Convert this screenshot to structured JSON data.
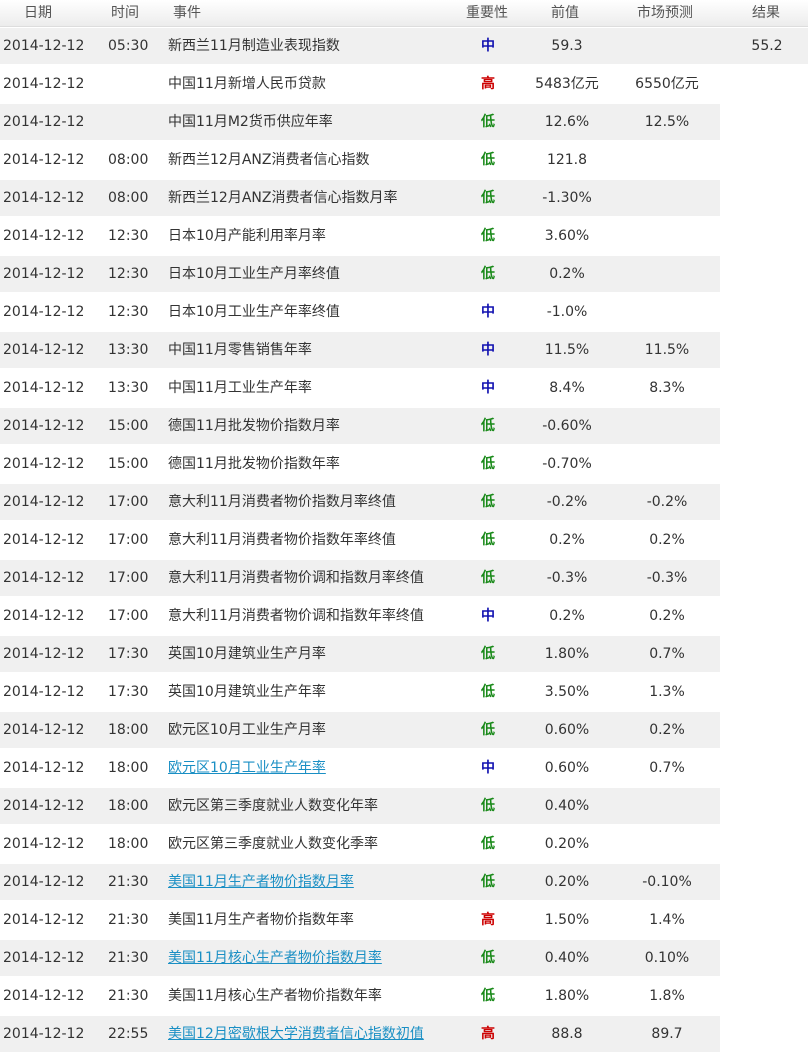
{
  "header": {
    "date": "日期",
    "time": "时间",
    "event": "事件",
    "importance": "重要性",
    "previous": "前值",
    "forecast": "市场预测",
    "result": "结果"
  },
  "importance_colors": {
    "高": "#cc0000",
    "中": "#1010b0",
    "低": "#1a8a1a"
  },
  "link_color": "#1a8fc4",
  "rows": [
    {
      "date": "2014-12-12",
      "time": "05:30",
      "event": "新西兰11月制造业表现指数",
      "importance": "中",
      "previous": "59.3",
      "forecast": "",
      "result": "55.2",
      "link": false
    },
    {
      "date": "2014-12-12",
      "time": "",
      "event": "中国11月新增人民币贷款",
      "importance": "高",
      "previous": "5483亿元",
      "forecast": "6550亿元",
      "result": "",
      "link": false
    },
    {
      "date": "2014-12-12",
      "time": "",
      "event": "中国11月M2货币供应年率",
      "importance": "低",
      "previous": "12.6%",
      "forecast": "12.5%",
      "result": "",
      "link": false
    },
    {
      "date": "2014-12-12",
      "time": "08:00",
      "event": "新西兰12月ANZ消费者信心指数",
      "importance": "低",
      "previous": "121.8",
      "forecast": "",
      "result": "",
      "link": false
    },
    {
      "date": "2014-12-12",
      "time": "08:00",
      "event": "新西兰12月ANZ消费者信心指数月率",
      "importance": "低",
      "previous": "-1.30%",
      "forecast": "",
      "result": "",
      "link": false
    },
    {
      "date": "2014-12-12",
      "time": "12:30",
      "event": "日本10月产能利用率月率",
      "importance": "低",
      "previous": "3.60%",
      "forecast": "",
      "result": "",
      "link": false
    },
    {
      "date": "2014-12-12",
      "time": "12:30",
      "event": "日本10月工业生产月率终值",
      "importance": "低",
      "previous": "0.2%",
      "forecast": "",
      "result": "",
      "link": false
    },
    {
      "date": "2014-12-12",
      "time": "12:30",
      "event": "日本10月工业生产年率终值",
      "importance": "中",
      "previous": "-1.0%",
      "forecast": "",
      "result": "",
      "link": false
    },
    {
      "date": "2014-12-12",
      "time": "13:30",
      "event": "中国11月零售销售年率",
      "importance": "中",
      "previous": "11.5%",
      "forecast": "11.5%",
      "result": "",
      "link": false
    },
    {
      "date": "2014-12-12",
      "time": "13:30",
      "event": "中国11月工业生产年率",
      "importance": "中",
      "previous": "8.4%",
      "forecast": "8.3%",
      "result": "",
      "link": false
    },
    {
      "date": "2014-12-12",
      "time": "15:00",
      "event": "德国11月批发物价指数月率",
      "importance": "低",
      "previous": "-0.60%",
      "forecast": "",
      "result": "",
      "link": false
    },
    {
      "date": "2014-12-12",
      "time": "15:00",
      "event": "德国11月批发物价指数年率",
      "importance": "低",
      "previous": "-0.70%",
      "forecast": "",
      "result": "",
      "link": false
    },
    {
      "date": "2014-12-12",
      "time": "17:00",
      "event": "意大利11月消费者物价指数月率终值",
      "importance": "低",
      "previous": "-0.2%",
      "forecast": "-0.2%",
      "result": "",
      "link": false
    },
    {
      "date": "2014-12-12",
      "time": "17:00",
      "event": "意大利11月消费者物价指数年率终值",
      "importance": "低",
      "previous": "0.2%",
      "forecast": "0.2%",
      "result": "",
      "link": false
    },
    {
      "date": "2014-12-12",
      "time": "17:00",
      "event": "意大利11月消费者物价调和指数月率终值",
      "importance": "低",
      "previous": "-0.3%",
      "forecast": "-0.3%",
      "result": "",
      "link": false
    },
    {
      "date": "2014-12-12",
      "time": "17:00",
      "event": "意大利11月消费者物价调和指数年率终值",
      "importance": "中",
      "previous": "0.2%",
      "forecast": "0.2%",
      "result": "",
      "link": false
    },
    {
      "date": "2014-12-12",
      "time": "17:30",
      "event": "英国10月建筑业生产月率",
      "importance": "低",
      "previous": "1.80%",
      "forecast": "0.7%",
      "result": "",
      "link": false
    },
    {
      "date": "2014-12-12",
      "time": "17:30",
      "event": "英国10月建筑业生产年率",
      "importance": "低",
      "previous": "3.50%",
      "forecast": "1.3%",
      "result": "",
      "link": false
    },
    {
      "date": "2014-12-12",
      "time": "18:00",
      "event": "欧元区10月工业生产月率",
      "importance": "低",
      "previous": "0.60%",
      "forecast": "0.2%",
      "result": "",
      "link": false
    },
    {
      "date": "2014-12-12",
      "time": "18:00",
      "event": "欧元区10月工业生产年率",
      "importance": "中",
      "previous": "0.60%",
      "forecast": "0.7%",
      "result": "",
      "link": true
    },
    {
      "date": "2014-12-12",
      "time": "18:00",
      "event": "欧元区第三季度就业人数变化年率",
      "importance": "低",
      "previous": "0.40%",
      "forecast": "",
      "result": "",
      "link": false
    },
    {
      "date": "2014-12-12",
      "time": "18:00",
      "event": "欧元区第三季度就业人数变化季率",
      "importance": "低",
      "previous": "0.20%",
      "forecast": "",
      "result": "",
      "link": false
    },
    {
      "date": "2014-12-12",
      "time": "21:30",
      "event": "美国11月生产者物价指数月率",
      "importance": "低",
      "previous": "0.20%",
      "forecast": "-0.10%",
      "result": "",
      "link": true
    },
    {
      "date": "2014-12-12",
      "time": "21:30",
      "event": "美国11月生产者物价指数年率",
      "importance": "高",
      "previous": "1.50%",
      "forecast": "1.4%",
      "result": "",
      "link": false
    },
    {
      "date": "2014-12-12",
      "time": "21:30",
      "event": "美国11月核心生产者物价指数月率",
      "importance": "低",
      "previous": "0.40%",
      "forecast": "0.10%",
      "result": "",
      "link": true
    },
    {
      "date": "2014-12-12",
      "time": "21:30",
      "event": "美国11月核心生产者物价指数年率",
      "importance": "低",
      "previous": "1.80%",
      "forecast": "1.8%",
      "result": "",
      "link": false
    },
    {
      "date": "2014-12-12",
      "time": "22:55",
      "event": "美国12月密歇根大学消费者信心指数初值",
      "importance": "高",
      "previous": "88.8",
      "forecast": "89.7",
      "result": "",
      "link": true
    }
  ]
}
